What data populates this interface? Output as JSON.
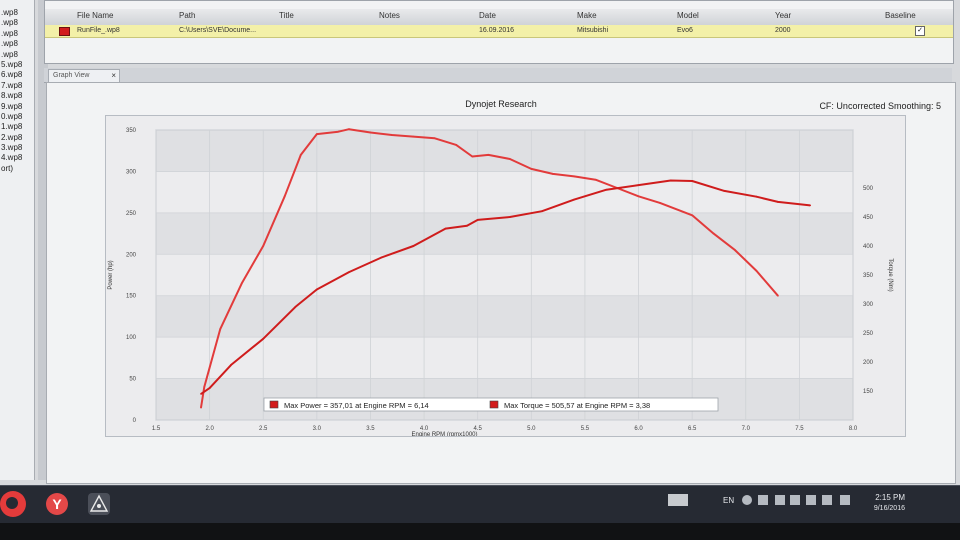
{
  "left_panel": {
    "files": [
      ".wp8",
      ".wp8",
      ".wp8",
      ".wp8",
      ".wp8",
      "5.wp8",
      "6.wp8",
      "7.wp8",
      "8.wp8",
      "9.wp8",
      "0.wp8",
      "1.wp8",
      "2.wp8",
      "3.wp8",
      "4.wp8",
      "ort)"
    ]
  },
  "table": {
    "columns": [
      "File Name",
      "Path",
      "Title",
      "Notes",
      "Date",
      "Make",
      "Model",
      "Year",
      "Baseline"
    ],
    "row": {
      "file_name": "RunFile_.wp8",
      "path": "C:\\Users\\SVE\\Docume...",
      "title": "",
      "notes": "",
      "date": "16.09.2016",
      "make": "Mitsubishi",
      "model": "Evo6",
      "year": "2000",
      "baseline_checked": true,
      "color": "#d21c1c"
    }
  },
  "graph_tab": {
    "label": "Graph View",
    "close": "×"
  },
  "graph": {
    "title": "Dynojet Research",
    "cf_label": "CF: Uncorrected Smoothing: 5",
    "left_axis_label": "Power (hp)",
    "right_axis_label": "Torque (Nm)",
    "x_axis_label": "Engine RPM (rpmx1000)"
  },
  "chart_data": {
    "type": "line",
    "xlabel": "Engine RPM (rpmx1000)",
    "ylabel": "Power (hp)",
    "y2label": "Torque (Nm)",
    "xlim": [
      1.5,
      8.0
    ],
    "ylim": [
      0,
      350
    ],
    "y2lim": [
      100,
      600
    ],
    "x_ticks": [
      "1.5",
      "2.0",
      "2.5",
      "3.0",
      "3.5",
      "4.0",
      "4.5",
      "5.0",
      "5.5",
      "6.0",
      "6.5",
      "7.0",
      "7.5",
      "8.0"
    ],
    "y_ticks": [
      "0",
      "50",
      "100",
      "150",
      "200",
      "250",
      "300",
      "350"
    ],
    "y2_ticks": [
      "150",
      "200",
      "250",
      "300",
      "350",
      "400",
      "450",
      "500"
    ],
    "grid": true,
    "series": [
      {
        "name": "Power",
        "axis": "left",
        "color": "#e23b3b",
        "x": [
          1.92,
          1.95,
          2.1,
          2.3,
          2.5,
          2.7,
          2.85,
          3.0,
          3.2,
          3.3,
          3.5,
          3.7,
          3.9,
          4.1,
          4.3,
          4.45,
          4.6,
          4.8,
          5.0,
          5.2,
          5.4,
          5.6,
          5.8,
          6.0,
          6.2,
          6.5,
          6.7,
          6.9,
          7.1,
          7.3
        ],
        "y": [
          15,
          40,
          110,
          165,
          210,
          270,
          320,
          345,
          348,
          351,
          347,
          344,
          342,
          340,
          332,
          318,
          320,
          315,
          303,
          297,
          294,
          290,
          280,
          270,
          262,
          247,
          225,
          205,
          180,
          150
        ]
      },
      {
        "name": "Torque",
        "axis": "right",
        "color": "#cf1c1c",
        "x": [
          1.92,
          2.0,
          2.2,
          2.5,
          2.8,
          3.0,
          3.3,
          3.6,
          3.9,
          4.2,
          4.4,
          4.5,
          4.8,
          5.1,
          5.4,
          5.7,
          6.0,
          6.3,
          6.5,
          6.8,
          7.1,
          7.3,
          7.6
        ],
        "y": [
          145,
          155,
          195,
          240,
          295,
          325,
          355,
          380,
          400,
          430,
          435,
          445,
          450,
          460,
          480,
          497,
          505,
          513,
          512,
          495,
          485,
          476,
          470
        ]
      }
    ],
    "legend": [
      {
        "label": "Max Power = 357,01 at Engine RPM = 6,14",
        "color": "#d21c1c"
      },
      {
        "label": "Max Torque = 505,57 at Engine RPM = 3,38",
        "color": "#d21c1c"
      }
    ],
    "legend_placement": "bottom-center"
  },
  "taskbar": {
    "yandex_label": "Y",
    "lang": "EN",
    "time": "2:15 PM",
    "date": "9/16/2016"
  }
}
